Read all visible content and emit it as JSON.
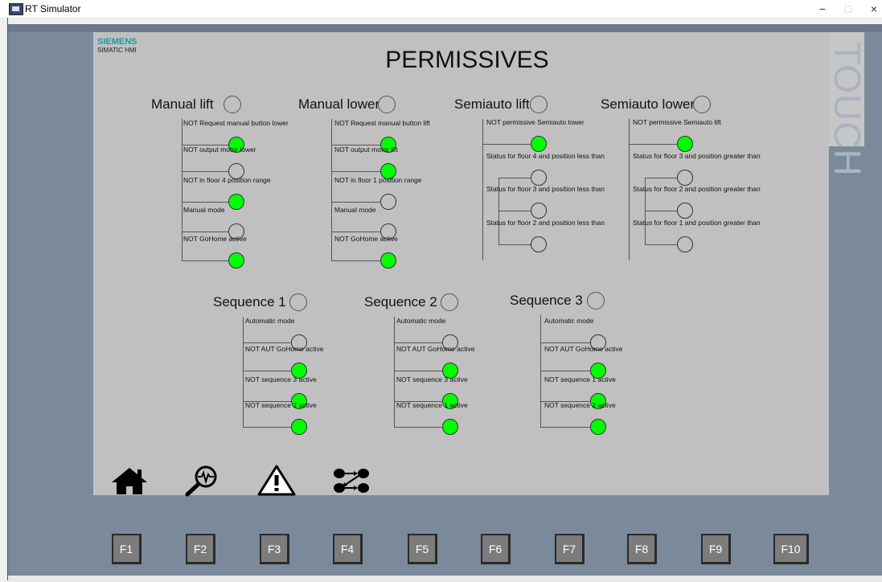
{
  "window": {
    "title": "RT Simulator",
    "minimize": "−",
    "maximize": "□",
    "close": "×"
  },
  "panel": {
    "brand": "SIEMENS",
    "model": "SIMATIC HMI",
    "side_label": "TOUCH"
  },
  "page_title": "PERMISSIVES",
  "groups": {
    "manual_lift": {
      "title": "Manual lift",
      "items": [
        {
          "label": "NOT Request manual button lower",
          "state": "on"
        },
        {
          "label": "NOT output motor lower",
          "state": "off"
        },
        {
          "label": "NOT in floor 4 position range",
          "state": "on"
        },
        {
          "label": "Manual mode",
          "state": "off"
        },
        {
          "label": "NOT GoHome active",
          "state": "on"
        }
      ]
    },
    "manual_lower": {
      "title": "Manual lower",
      "items": [
        {
          "label": "NOT Request manual button lift",
          "state": "on"
        },
        {
          "label": "NOT output motor lift",
          "state": "on"
        },
        {
          "label": "NOT in floor 1 position range",
          "state": "off"
        },
        {
          "label": "Manual mode",
          "state": "off"
        },
        {
          "label": "NOT GoHome active",
          "state": "on"
        }
      ]
    },
    "semiauto_lift": {
      "title": "Semiauto lift",
      "items": [
        {
          "label": "NOT permissive Semiauto lower",
          "state": "on"
        },
        {
          "label": "Status for floor 4 and position less than",
          "state": "off"
        },
        {
          "label": "Status for floor 3 and position less than",
          "state": "off"
        },
        {
          "label": "Status for floor 2 and position less than",
          "state": "off"
        }
      ]
    },
    "semiauto_lower": {
      "title": "Semiauto lower",
      "items": [
        {
          "label": "NOT permissive Semiauto lift",
          "state": "on"
        },
        {
          "label": "Status for floor 3 and position greater than",
          "state": "off"
        },
        {
          "label": "Status for floor 2 and position greater than",
          "state": "off"
        },
        {
          "label": "Status for floor 1 and position greater than",
          "state": "off"
        }
      ]
    },
    "sequence_1": {
      "title": "Sequence 1",
      "items": [
        {
          "label": "Automatic mode",
          "state": "off"
        },
        {
          "label": "NOT AUT GoHome active",
          "state": "on"
        },
        {
          "label": "NOT sequence 3 active",
          "state": "on"
        },
        {
          "label": "NOT sequence 2 active",
          "state": "on"
        }
      ]
    },
    "sequence_2": {
      "title": "Sequence 2",
      "items": [
        {
          "label": "Automatic mode",
          "state": "off"
        },
        {
          "label": "NOT AUT GoHome active",
          "state": "on"
        },
        {
          "label": "NOT sequence 3 active",
          "state": "on"
        },
        {
          "label": "NOT sequence 1 active",
          "state": "on"
        }
      ]
    },
    "sequence_3": {
      "title": "Sequence 3",
      "items": [
        {
          "label": "Automatic mode",
          "state": "off"
        },
        {
          "label": "NOT AUT GoHome active",
          "state": "on"
        },
        {
          "label": "NOT sequence 1 active",
          "state": "on"
        },
        {
          "label": "NOT sequence 2 active",
          "state": "on"
        }
      ]
    }
  },
  "nav_icons": [
    "home-icon",
    "diagnostics-icon",
    "alarm-warning-icon",
    "sequence-flow-icon"
  ],
  "function_keys": [
    "F1",
    "F2",
    "F3",
    "F4",
    "F5",
    "F6",
    "F7",
    "F8",
    "F9",
    "F10"
  ],
  "colors": {
    "led_on": "#00ff00",
    "led_off": "#c0c0c0",
    "screen_bg": "#c0c0c0",
    "bezel": "#7b8a9b",
    "brand": "#1a9aa3"
  }
}
